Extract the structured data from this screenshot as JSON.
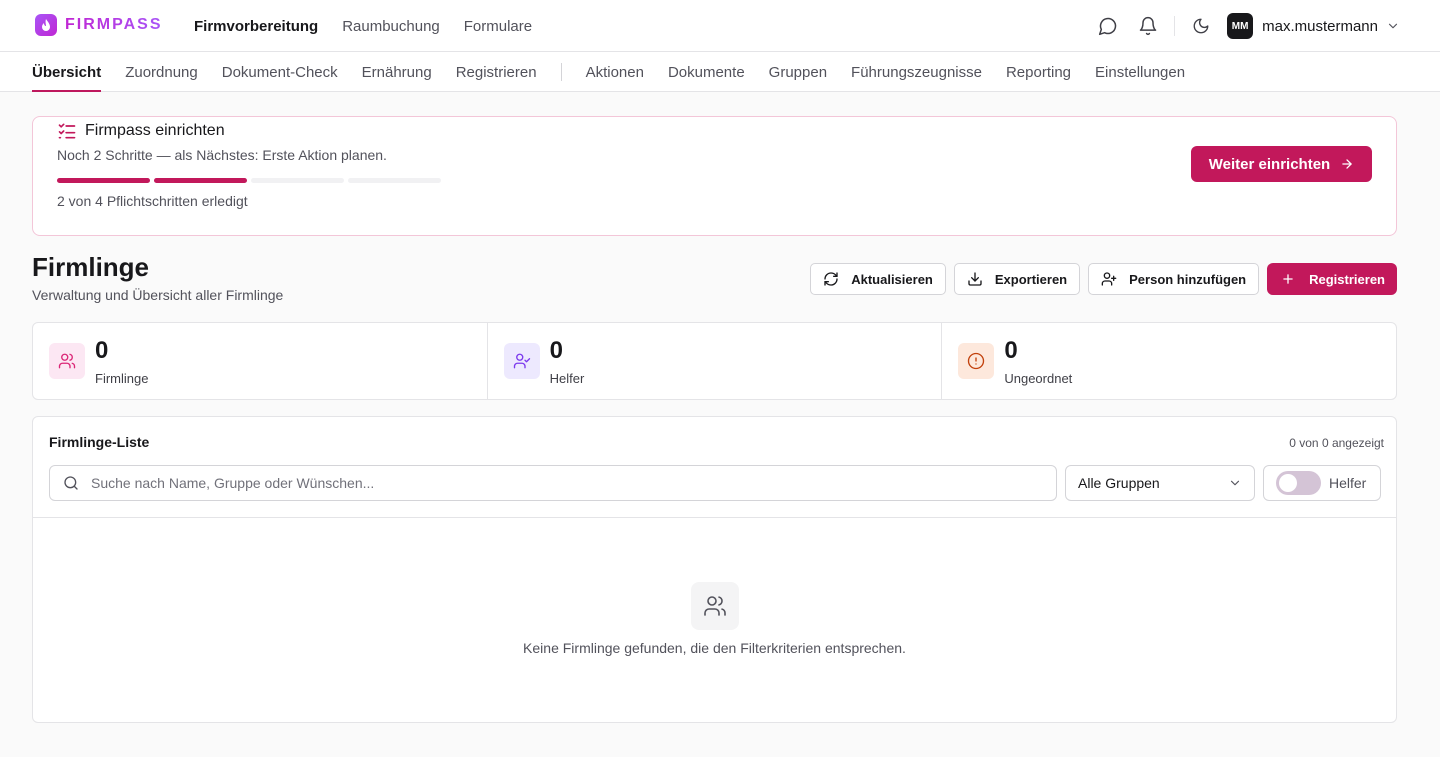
{
  "app": {
    "brand": "FIRMPASS"
  },
  "main_nav": [
    {
      "label": "Firmvorbereitung",
      "active": true
    },
    {
      "label": "Raumbuchung",
      "active": false
    },
    {
      "label": "Formulare",
      "active": false
    }
  ],
  "user": {
    "initials": "MM",
    "name": "max.mustermann"
  },
  "sub_nav": [
    {
      "label": "Übersicht",
      "active": true
    },
    {
      "label": "Zuordnung"
    },
    {
      "label": "Dokument-Check"
    },
    {
      "label": "Ernährung"
    },
    {
      "label": "Registrieren"
    },
    {
      "label": "Aktionen"
    },
    {
      "label": "Dokumente"
    },
    {
      "label": "Gruppen"
    },
    {
      "label": "Führungszeugnisse"
    },
    {
      "label": "Reporting"
    },
    {
      "label": "Einstellungen"
    }
  ],
  "setup": {
    "title": "Firmpass einrichten",
    "description": "Noch 2 Schritte — als Nächstes: Erste Aktion planen.",
    "steps_done": 2,
    "steps_total": 4,
    "count_text": "2 von 4 Pflichtschritten erledigt",
    "button_label": "Weiter einrichten"
  },
  "page": {
    "title": "Firmlinge",
    "subtitle": "Verwaltung und Übersicht aller Firmlinge"
  },
  "actions": {
    "refresh": "Aktualisieren",
    "export": "Exportieren",
    "add_person": "Person hinzufügen",
    "register": "Registrieren"
  },
  "stats": [
    {
      "value": "0",
      "label": "Firmlinge",
      "icon": "users-icon",
      "color": "#db2777",
      "bg": "#fce7f3"
    },
    {
      "value": "0",
      "label": "Helfer",
      "icon": "user-check-icon",
      "color": "#7c3aed",
      "bg": "#ede9fe"
    },
    {
      "value": "0",
      "label": "Ungeordnet",
      "icon": "alert-circle-icon",
      "color": "#c2410c",
      "bg": "#fde8dc"
    }
  ],
  "list": {
    "title": "Firmlinge-Liste",
    "count_text": "0 von 0 angezeigt",
    "search_placeholder": "Suche nach Name, Gruppe oder Wünschen...",
    "group_select": "Alle Gruppen",
    "toggle_label": "Helfer",
    "toggle_on": false,
    "empty_text": "Keine Firmlinge gefunden, die den Filterkriterien entsprechen."
  },
  "colors": {
    "accent": "#c2185b",
    "border": "#e4e4e7"
  }
}
